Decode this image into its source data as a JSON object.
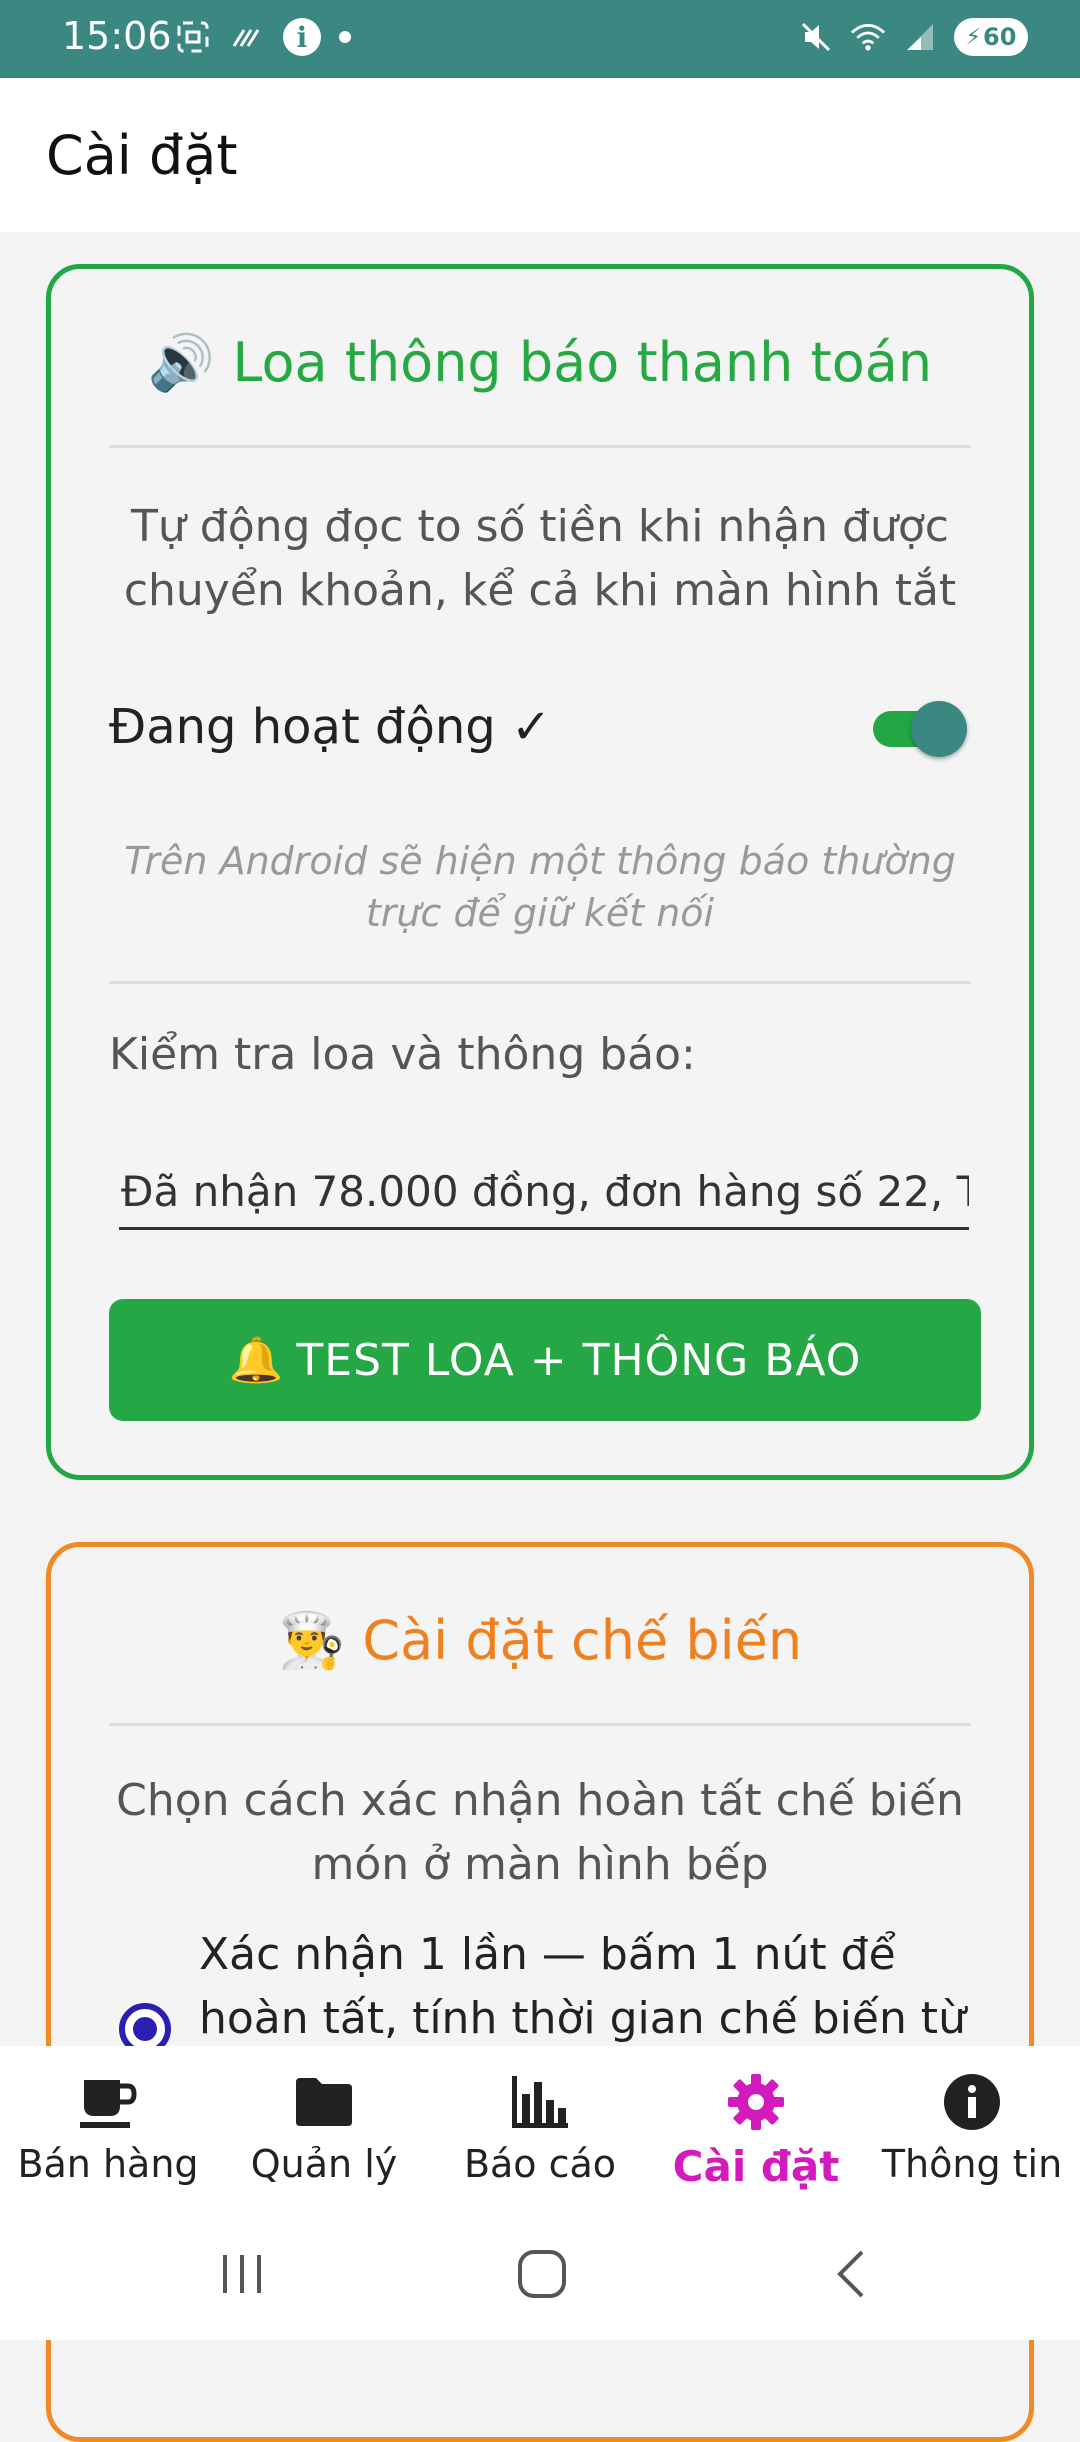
{
  "status_bar": {
    "time": "15:06",
    "battery": "60",
    "icons": [
      "screenshot-icon",
      "data-saver-icon",
      "info-icon",
      "dot-icon",
      "mute-icon",
      "wifi-icon",
      "signal-icon",
      "battery-icon"
    ]
  },
  "app_bar": {
    "title": "Cài đặt"
  },
  "speaker_card": {
    "title": "Loa thông báo thanh toán",
    "title_icon": "🔊",
    "description": "Tự động đọc to số tiền khi nhận được chuyển khoản, kể cả khi màn hình tắt",
    "toggle_label": "Đang hoạt động ✓",
    "toggle_on": true,
    "note": "Trên Android sẽ hiện một thông báo thường trực để giữ kết nối",
    "test_label": "Kiểm tra loa và thông báo:",
    "test_input_value": "Đã nhận 78.000 đồng, đơn hàng số 22, T",
    "test_button_icon": "🔔",
    "test_button_label": "TEST LOA + THÔNG BÁO",
    "accent": "#23a745"
  },
  "kitchen_card": {
    "title": "Cài đặt chế biến",
    "title_icon": "👨‍🍳",
    "description": "Chọn cách xác nhận hoàn tất chế biến món ở màn hình bếp",
    "option_1": "Xác nhận 1 lần — bấm 1 nút để hoàn tất, tính thời gian chế biến từ",
    "option_1_selected": true,
    "accent": "#f08a24"
  },
  "bottom_nav": {
    "items": [
      {
        "label": "Bán hàng",
        "icon": "coffee-cup-icon"
      },
      {
        "label": "Quản lý",
        "icon": "folder-icon"
      },
      {
        "label": "Báo cáo",
        "icon": "bar-chart-icon"
      },
      {
        "label": "Cài đặt",
        "icon": "gear-icon",
        "active": true
      },
      {
        "label": "Thông tin",
        "icon": "info-icon"
      }
    ],
    "active_color": "#d21abd"
  }
}
